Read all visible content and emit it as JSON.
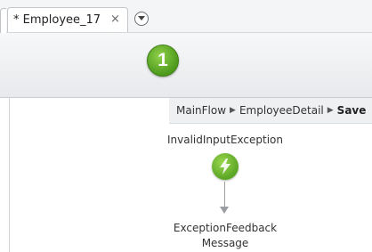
{
  "tabs": [
    {
      "title": "* Employee_17",
      "close": "×"
    }
  ],
  "toolbar": {
    "step_badge": "1"
  },
  "breadcrumb": {
    "items": [
      "MainFlow",
      "EmployeeDetail",
      "Save"
    ],
    "separator": "▶"
  },
  "flow": {
    "exception_handler": "InvalidInputException",
    "target_line1": "ExceptionFeedback",
    "target_line2": "Message"
  },
  "icons": {
    "tab_dropdown": "chevron-down-icon",
    "exception": "lightning-icon"
  },
  "colors": {
    "badge": "#5aa524",
    "exception_node": "#5aa524"
  }
}
